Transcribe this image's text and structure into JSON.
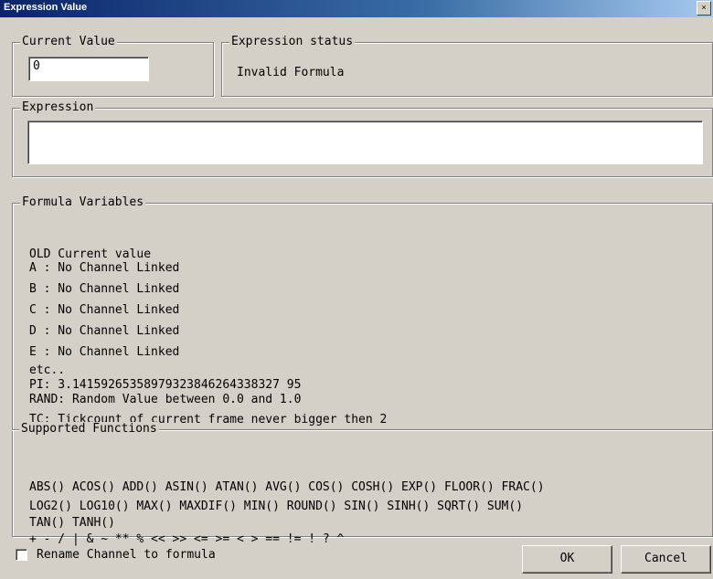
{
  "window": {
    "title": "Expression Value",
    "close_glyph": "×"
  },
  "current_value": {
    "label": "Current Value",
    "value": "0"
  },
  "expression_status": {
    "label": "Expression status",
    "text": "Invalid Formula"
  },
  "expression": {
    "label": "Expression",
    "value": ""
  },
  "formula_variables": {
    "label": "Formula Variables",
    "lines": [
      "OLD Current value",
      "A : No Channel Linked",
      "B : No Channel Linked",
      "C : No Channel Linked",
      "D : No Channel Linked",
      "E : No Channel Linked",
      "etc..",
      "PI: 3.14159265358979323846264338327 95",
      "RAND: Random Value between 0.0 and 1.0",
      "TC: Tickcount of current frame never bigger then 2"
    ]
  },
  "supported_functions": {
    "label": "Supported Functions",
    "lines": [
      "ABS() ACOS() ADD() ASIN() ATAN() AVG() COS() COSH() EXP() FLOOR() FRAC()",
      "LOG2() LOG10() MAX() MAXDIF() MIN() ROUND() SIN() SINH() SQRT() SUM()",
      "TAN() TANH()",
      "+ - / | & ~ ** % << >> <= >= < > ==  != ! ? ^"
    ]
  },
  "rename_checkbox": {
    "label": "Rename Channel to formula",
    "checked": false
  },
  "buttons": {
    "ok": "OK",
    "cancel": "Cancel"
  }
}
